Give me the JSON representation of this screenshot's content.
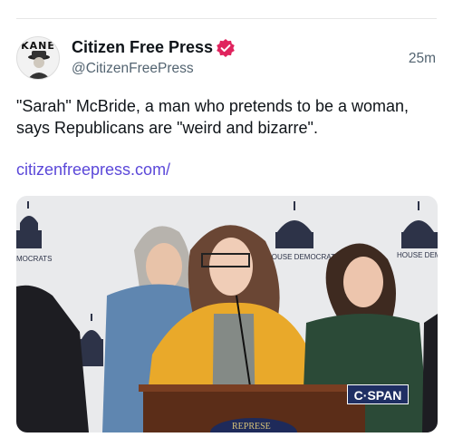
{
  "post": {
    "author": {
      "display_name": "Citizen Free Press",
      "handle": "@CitizenFreePress",
      "avatar_text": "KANE",
      "verified_color": "#e0245e"
    },
    "timestamp": "25m",
    "text": "\"Sarah\" McBride, a man who pretends to be a woman, says Republicans are \"weird and bizarre\".",
    "link": "citizenfreepress.com/",
    "media": {
      "backdrop_labels": [
        "MOCRATS",
        "HOUSE DEMOCRATS",
        "HOUSE DEMOCR"
      ],
      "watermark": "C·SPAN",
      "seal_text": "REPRESE"
    }
  },
  "colors": {
    "link": "#5b48d9",
    "secondary_text": "#536471",
    "cspan_bg": "#1f2f63"
  }
}
